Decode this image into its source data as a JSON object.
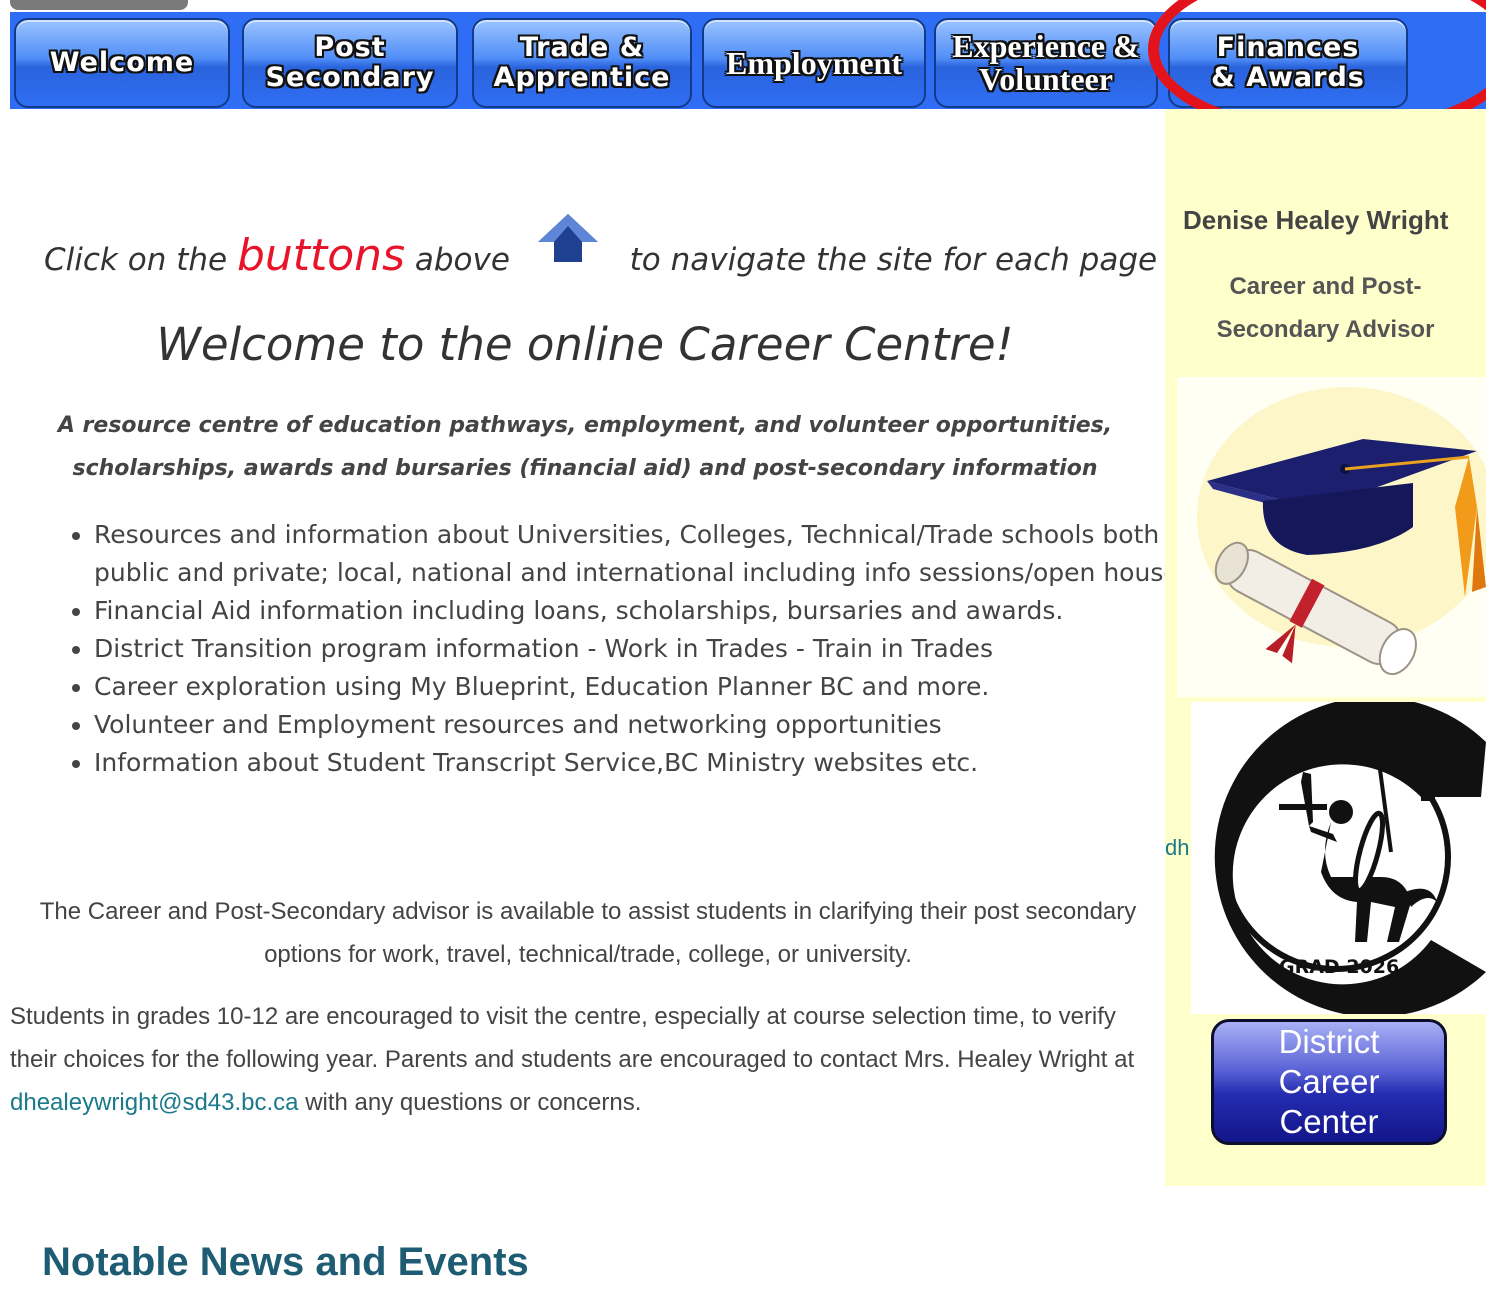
{
  "nav": {
    "buttons": [
      {
        "label": "Welcome"
      },
      {
        "label": "Post\nSecondary"
      },
      {
        "label": "Trade &\nApprentice"
      },
      {
        "label": "Employment"
      },
      {
        "label": "Experience &\nVolunteer"
      },
      {
        "label": "Finances\n& Awards"
      }
    ],
    "bar_color": "#2f6ef4",
    "highlight_color": "#e3131b"
  },
  "main": {
    "instruction": {
      "before": "Click on the",
      "emphasis": "buttons",
      "after": "above",
      "end": "to navigate the site for each page",
      "arrow_icon": "up-arrow-icon"
    },
    "title": "Welcome to the  online Career Centre!",
    "tagline": "A resource centre of education pathways, employment, and volunteer opportunities, scholarships, awards and bursaries (financial aid)  and post-secondary information",
    "bullets": [
      "Resources and information about Universities, Colleges, Technical/Trade schools both public and private; local, national and international including info sessions/open houses.",
      "Financial Aid information including loans, scholarships, bursaries and awards.",
      "District Transition program information -  Work in Trades - Train in Trades",
      "Career exploration using My Blueprint, Education Planner BC and more.",
      "Volunteer and Employment resources and networking opportunities",
      " Information about Student Transcript Service,BC Ministry websites etc."
    ],
    "para1": "The Career and Post-Secondary advisor is available to assist students in clarifying their post secondary options for work, travel,  technical/trade, college, or university.",
    "para2_before": " Students in grades 10-12 are encouraged to visit the centre, especially at course selection time, to verify their choices for the following year. Parents and students are encouraged to contact Mrs. Healey Wright at ",
    "para2_email": "dhealeywright@sd43.bc.ca",
    "para2_after": "  with any questions or concerns.",
    "news_heading": "Notable News and Events"
  },
  "sidebar": {
    "name": "Denise  Healey Wright",
    "title": "Career and Post-\nSecondary Advisor",
    "graduation_image": "graduation-cap-diploma-icon",
    "crest_label": "GRAD 2026",
    "crest_image": "centaur-crest-logo",
    "email_fragment": "dh",
    "district_button": "District\nCareer\nCenter",
    "background": "#ffffcc"
  }
}
